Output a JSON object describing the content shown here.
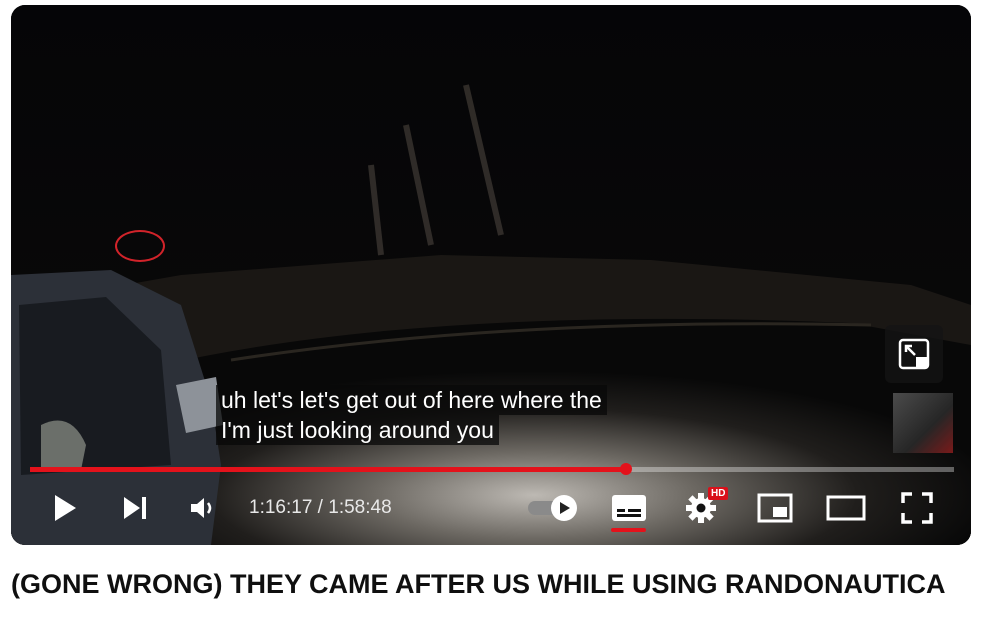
{
  "video": {
    "captions": [
      "uh let's let's get out of here where the",
      "I'm just looking around you"
    ],
    "current_time": "1:16:17",
    "duration": "1:58:48",
    "time_separator": " / ",
    "progress_fraction": 0.645,
    "hd_badge": "HD",
    "accent_color": "#e4121b"
  },
  "controls": {
    "play_icon": "play-icon",
    "next_icon": "next-icon",
    "volume_icon": "volume-icon",
    "autoplay_icon": "autoplay-toggle-icon",
    "captions_icon": "captions-icon",
    "settings_icon": "gear-icon",
    "miniplayer_icon": "miniplayer-icon",
    "theater_icon": "theater-icon",
    "fullscreen_icon": "fullscreen-icon"
  },
  "title": "(GONE WRONG) THEY CAME AFTER US WHILE USING RANDONAUTICA"
}
